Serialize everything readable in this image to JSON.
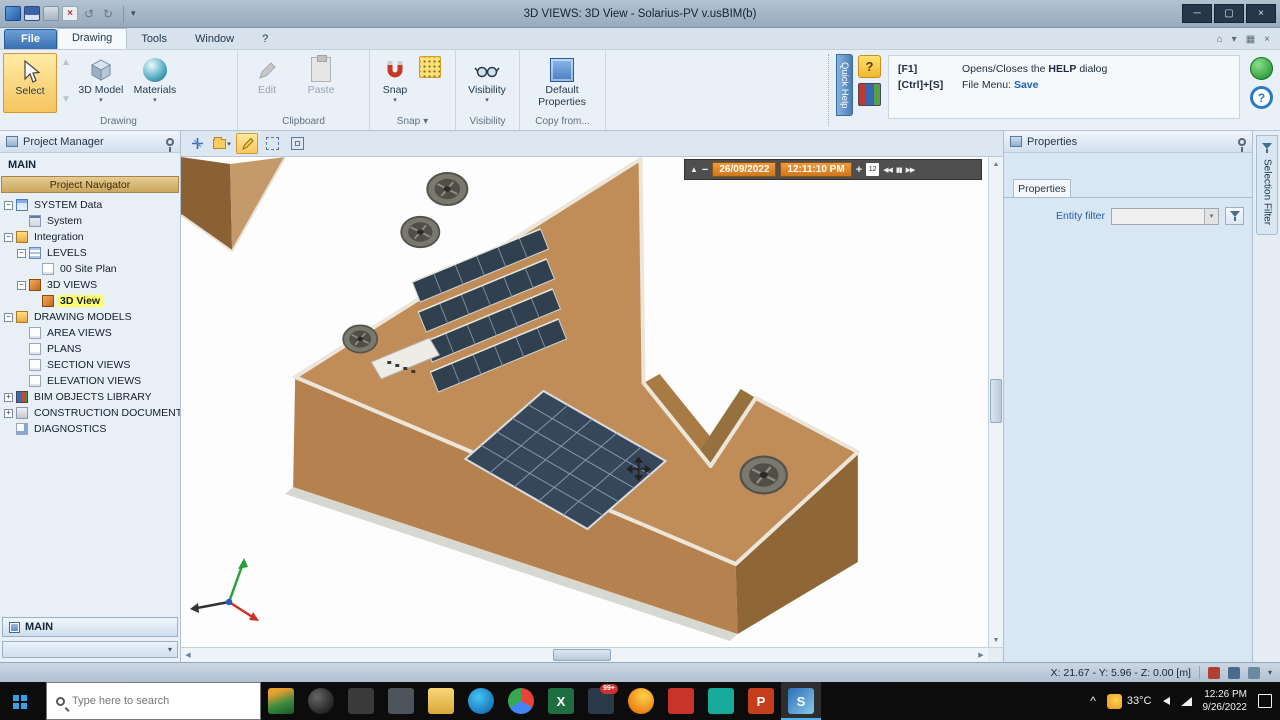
{
  "titlebar": {
    "title": "3D VIEWS: 3D View - Solarius-PV v.usBIM(b)"
  },
  "menu": {
    "file": "File",
    "drawing": "Drawing",
    "tools": "Tools",
    "window": "Window",
    "help": "?"
  },
  "ribbon": {
    "select": "Select",
    "model": "3D Model",
    "materials": "Materials",
    "group_drawing": "Drawing",
    "edit": "Edit",
    "paste": "Paste",
    "group_clipboard": "Clipboard",
    "snap": "Snap",
    "group_snap": "Snap",
    "visibility": "Visibility",
    "group_visibility": "Visibility",
    "default_properties": "Default Properties",
    "group_copyfrom": "Copy from...",
    "quick_help": "Quick Help"
  },
  "help_panel": {
    "row1_key": "[F1]",
    "row1_pre": "Opens/Closes the ",
    "row1_bold": "HELP",
    "row1_post": " dialog",
    "row2_key": "[Ctrl]+[S]",
    "row2_pre": "File Menu: ",
    "row2_link": "Save"
  },
  "project": {
    "header": "Project Manager",
    "section": "MAIN",
    "navigator": "Project Navigator",
    "tree": [
      {
        "label": "SYSTEM Data",
        "level": 0,
        "expand": "minus",
        "icon": "grid"
      },
      {
        "label": "System",
        "level": 1,
        "expand": "none",
        "icon": "sys"
      },
      {
        "label": "Integration",
        "level": 0,
        "expand": "minus",
        "icon": "folder"
      },
      {
        "label": "LEVELS",
        "level": 1,
        "expand": "minus",
        "icon": "levels"
      },
      {
        "label": "00 Site Plan",
        "level": 2,
        "expand": "none",
        "icon": "page"
      },
      {
        "label": "3D VIEWS",
        "level": 1,
        "expand": "minus",
        "icon": "cube"
      },
      {
        "label": "3D View",
        "level": 2,
        "expand": "none",
        "icon": "cube",
        "selected": true
      },
      {
        "label": "DRAWING MODELS",
        "level": 0,
        "expand": "minus",
        "icon": "folder"
      },
      {
        "label": "AREA VIEWS",
        "level": 1,
        "expand": "none",
        "icon": "page"
      },
      {
        "label": "PLANS",
        "level": 1,
        "expand": "none",
        "icon": "page"
      },
      {
        "label": "SECTION VIEWS",
        "level": 1,
        "expand": "none",
        "icon": "page"
      },
      {
        "label": "ELEVATION VIEWS",
        "level": 1,
        "expand": "none",
        "icon": "page"
      },
      {
        "label": "BIM OBJECTS LIBRARY",
        "level": 0,
        "expand": "plus",
        "icon": "book"
      },
      {
        "label": "CONSTRUCTION DOCUMENTS",
        "level": 0,
        "expand": "plus",
        "icon": "stack"
      },
      {
        "label": "DIAGNOSTICS",
        "level": 0,
        "expand": "none",
        "icon": "diag"
      }
    ],
    "bottom_button": "MAIN"
  },
  "viewport": {
    "date": "26/09/2022",
    "time": "12:11:10 PM",
    "calendar_day": "12"
  },
  "properties": {
    "header": "Properties",
    "tab": "Properties",
    "entity_filter": "Entity filter"
  },
  "selection_filter": "Selection Filter",
  "status": {
    "coords": "X: 21.67 - Y: 5.96 - Z: 0.00 [m]"
  },
  "taskbar": {
    "search_placeholder": "Type here to search",
    "apps": [
      {
        "name": "photos-app-icon",
        "bg": "linear-gradient(160deg,#e8a030 20%,#3a8a40 60%,#1a5a2a)"
      },
      {
        "name": "dark-sphere-app-icon",
        "bg": "radial-gradient(circle at 35% 35%,#666,#0a0a0a)",
        "round": true
      },
      {
        "name": "task-view-app-icon",
        "bg": "#3a3a3a"
      },
      {
        "name": "widgets-app-icon",
        "bg": "rgba(200,220,240,0.35)"
      },
      {
        "name": "file-explorer-app-icon",
        "bg": "linear-gradient(#f8d878,#d8a838)"
      },
      {
        "name": "edge-app-icon",
        "bg": "radial-gradient(circle at 40% 35%,#45c5f5,#0a5aa4)",
        "round": true
      },
      {
        "name": "chrome-app-icon",
        "bg": "conic-gradient(#ea4335 0 33%,#4285f4 33% 66%,#34a853 66% 100%)",
        "round": true
      },
      {
        "name": "excel-app-icon",
        "bg": "#1e6e42",
        "glyph": "X"
      },
      {
        "name": "mail-app-icon",
        "bg": "#2b3a4a",
        "badge": "99+"
      },
      {
        "name": "firefox-app-icon",
        "bg": "radial-gradient(circle at 60% 30%,#ffd24a,#e66000)",
        "round": true
      },
      {
        "name": "pdf-app-icon",
        "bg": "#c8342a"
      },
      {
        "name": "chat-app-icon",
        "bg": "#18aa9a"
      },
      {
        "name": "powerpoint-app-icon",
        "bg": "#c43e1c",
        "glyph": "P"
      },
      {
        "name": "solarius-app-icon",
        "bg": "linear-gradient(135deg,#2a6fb8,#8ac8e8)",
        "glyph": "S",
        "active": true
      }
    ],
    "tray": {
      "temperature": "33°C",
      "time": "12:26 PM",
      "date": "9/26/2022"
    }
  },
  "icons": {
    "caret_down": "▾",
    "minimize": "─",
    "maximize": "▢",
    "close": "×",
    "home": "⌂",
    "grid": "▦",
    "sun_up": "▲",
    "sun_down": "−",
    "plus": "+",
    "skip_back": "◀◀",
    "pause": "▮▮",
    "skip_fwd": "▶▶",
    "scroll_up": "▲",
    "scroll_down": "▼",
    "scroll_left": "◀",
    "scroll_right": "▶",
    "tray_caret": "^",
    "help_q": "?",
    "select_up": "▲",
    "select_down": "▼",
    "undo": "↺",
    "redo": "↻"
  }
}
